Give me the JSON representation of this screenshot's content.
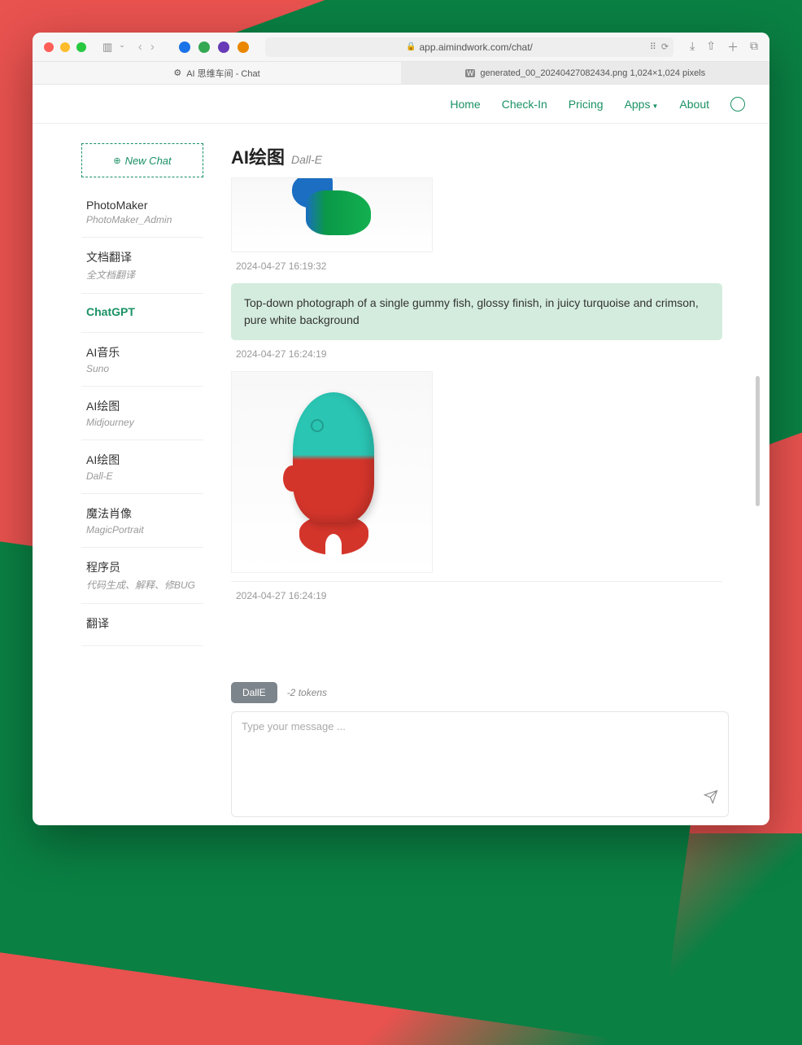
{
  "browser": {
    "url": "app.aimindwork.com/chat/",
    "tabs": [
      {
        "title": "AI 思维车间 - Chat"
      },
      {
        "title": "generated_00_20240427082434.png 1,024×1,024 pixels"
      }
    ]
  },
  "nav": [
    "Home",
    "Check-In",
    "Pricing",
    "Apps",
    "About"
  ],
  "sidebar": {
    "new_chat": "New Chat",
    "items": [
      {
        "title": "PhotoMaker",
        "sub": "PhotoMaker_Admin"
      },
      {
        "title": "文档翻译",
        "sub": "全文档翻译"
      },
      {
        "title": "ChatGPT"
      },
      {
        "title": "AI音乐",
        "sub": "Suno"
      },
      {
        "title": "AI绘图",
        "sub": "Midjourney"
      },
      {
        "title": "AI绘图",
        "sub": "Dall-E"
      },
      {
        "title": "魔法肖像",
        "sub": "MagicPortrait"
      },
      {
        "title": "程序员",
        "sub": "代码生成、解释、修BUG"
      },
      {
        "title": "翻译"
      }
    ]
  },
  "main": {
    "title": "AI绘图",
    "subtitle": "Dall-E",
    "messages": [
      {
        "ts": "2024-04-27 16:19:32"
      },
      {
        "text": "Top-down photograph of a single gummy fish, glossy finish, in juicy turquoise and crimson, pure white background",
        "ts": "2024-04-27 16:24:19"
      },
      {
        "ts": "2024-04-27 16:24:19"
      }
    ]
  },
  "composer": {
    "model": "DallE",
    "tokens": "-2 tokens",
    "placeholder": "Type your message ..."
  }
}
